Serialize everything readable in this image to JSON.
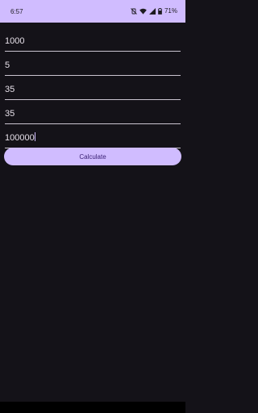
{
  "status_bar": {
    "time": "6:57",
    "battery": "71%",
    "icons": [
      "vibrate-off-icon",
      "wifi-icon",
      "signal-icon",
      "battery-icon"
    ]
  },
  "fields": [
    {
      "value": "1000"
    },
    {
      "value": "5"
    },
    {
      "value": "35"
    },
    {
      "value": "35"
    },
    {
      "value": "100000",
      "focused": true
    }
  ],
  "calculate_button": {
    "label": "Calculate"
  },
  "colors": {
    "accent": "#d0bcff",
    "background": "#141218",
    "on_surface": "#e6e0e9",
    "button_text": "#381e72"
  }
}
